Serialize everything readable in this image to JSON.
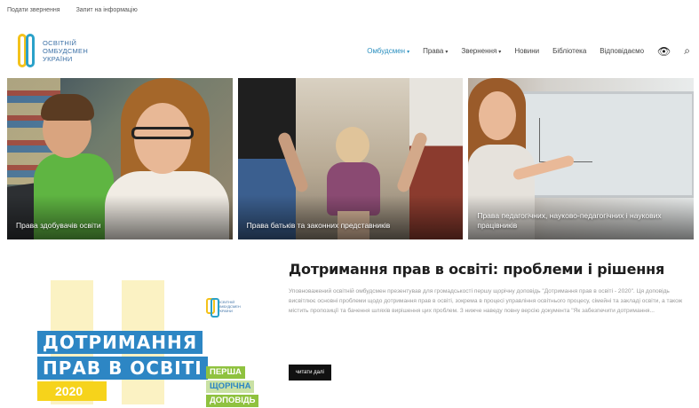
{
  "topbar": {
    "links": [
      "Подати звернення",
      "Запит на інформацію"
    ]
  },
  "logo": {
    "lines": [
      "ОСВІТНІЙ",
      "ОМБУДСМЕН",
      "УКРАЇНИ"
    ]
  },
  "nav": {
    "items": [
      {
        "label": "Омбудсмен",
        "caret": "▾",
        "active": true
      },
      {
        "label": "Права",
        "caret": "▾",
        "active": false
      },
      {
        "label": "Звернення",
        "caret": "▾",
        "active": false
      },
      {
        "label": "Новини",
        "caret": "",
        "active": false
      },
      {
        "label": "Бібліотека",
        "caret": "",
        "active": false
      },
      {
        "label": "Відповідаємо",
        "caret": "",
        "active": false
      }
    ],
    "eye_icon": "👁",
    "search_icon": "⌕",
    "accent_color": "#2a8fbf"
  },
  "tiles": [
    {
      "caption": "Права здобувачів освіти"
    },
    {
      "caption": "Права батьків та законних представників"
    },
    {
      "caption": "Права педагогічних, науково-педагогічних і наукових працівників"
    }
  ],
  "poster": {
    "logo_lines": [
      "ОСВІТНІЙ",
      "ОМБУДСМЕН",
      "УКРАЇНИ"
    ],
    "line1": "ДОТРИМАННЯ",
    "line2": "ПРАВ В ОСВІТІ",
    "year": "2020",
    "tag1": "ПЕРША",
    "tag2": "ЩОРІЧНА",
    "tag3": "ДОПОВІДЬ"
  },
  "article": {
    "title": "Дотримання прав в освіті: проблеми і рішення",
    "excerpt": "Уповноважений освітній омбудсмен презентував для громадськості першу щорічну доповідь \"Дотримання прав в освіті - 2020\". Ця доповідь висвітлює основні проблеми щодо дотримання прав в освіті, зокрема в процесі управління освітнього процесу, сімейні та закладі освіти, а також містить пропозиції та бачення шляхів вирішення цих проблем. З нижче наведу повну версію документа \"Як забезпечити дотримання...",
    "read_more": "читати далі"
  }
}
